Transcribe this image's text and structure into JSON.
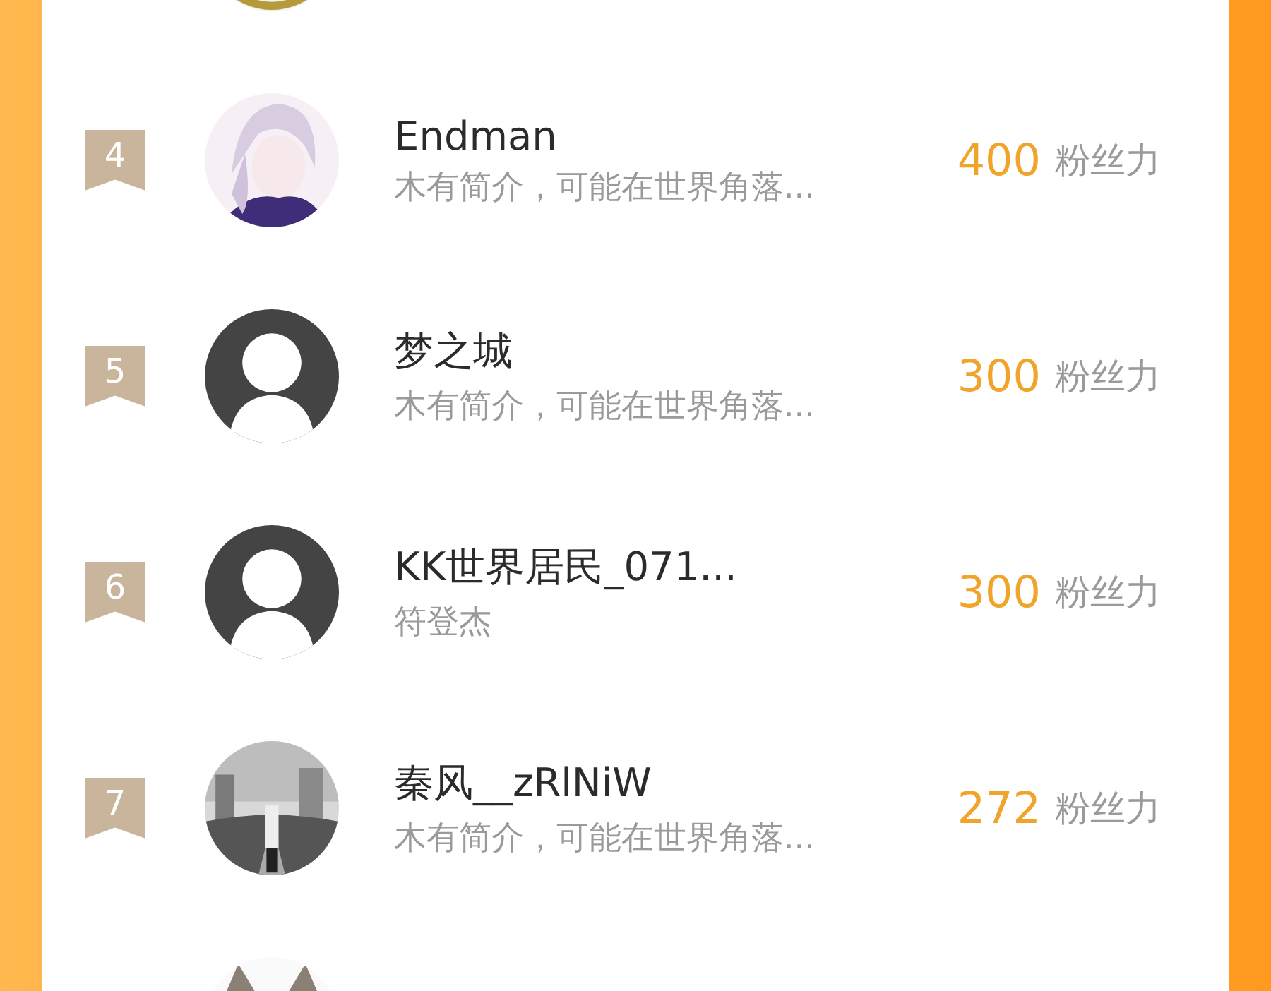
{
  "rows": [
    {
      "kind": "partial"
    },
    {
      "kind": "full",
      "rank": "4",
      "name": "Endman",
      "bio": "木有简介，可能在世界角落...",
      "score": "400",
      "unit": "粉丝力"
    },
    {
      "kind": "full",
      "rank": "5",
      "avatar": {
        "kind": "default"
      },
      "name": "梦之城",
      "bio": "木有简介，可能在世界角落...",
      "score": "300",
      "unit": "粉丝力"
    },
    {
      "kind": "full",
      "rank": "6",
      "avatar": {
        "kind": "default"
      },
      "name": "KK世界居民_071...",
      "bio": "符登杰",
      "score": "300",
      "unit": "粉丝力"
    },
    {
      "kind": "full",
      "rank": "7",
      "name": "秦风__zRlNiW",
      "bio": "木有简介，可能在世界角落...",
      "score": "272",
      "unit": "粉丝力"
    },
    {
      "kind": "partial"
    }
  ]
}
